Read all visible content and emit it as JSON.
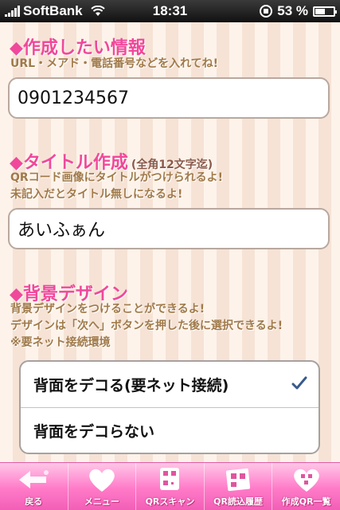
{
  "status_bar": {
    "carrier": "SoftBank",
    "time": "18:31",
    "battery": "53 %",
    "battery_level": 0.53
  },
  "info_section": {
    "title": "◆作成したい情報",
    "hint": "URL・メアド・電話番号などを入れてね!",
    "value": "0901234567"
  },
  "title_section": {
    "title": "◆タイトル作成",
    "note": "(全角12文字迄)",
    "hint_line1": "QRコード画像にタイトルがつけられるよ!",
    "hint_line2": "未記入だとタイトル無しになるよ!",
    "value": "あいふぁん"
  },
  "background_section": {
    "title": "◆背景デザイン",
    "hint_line1": "背景デザインをつけることができるよ!",
    "hint_line2": "デザインは「次へ」ボタンを押した後に選択できるよ!",
    "hint_line3": "※要ネット接続環境",
    "options": [
      {
        "label": "背面をデコる(要ネット接続)",
        "selected": true
      },
      {
        "label": "背面をデコらない",
        "selected": false
      }
    ]
  },
  "tabbar": {
    "items": [
      {
        "label": "戻る",
        "icon": "back-arrow-icon"
      },
      {
        "label": "メニュー",
        "icon": "heart-icon"
      },
      {
        "label": "QRスキャン",
        "icon": "qr-scan-icon"
      },
      {
        "label": "QR読込履歴",
        "icon": "history-icon"
      },
      {
        "label": "作成QR一覧",
        "icon": "qr-heart-list-icon"
      }
    ]
  },
  "colors": {
    "accent_pink": "#f0489b",
    "hint_brown": "#a07a4a",
    "check_blue": "#385a8c"
  }
}
